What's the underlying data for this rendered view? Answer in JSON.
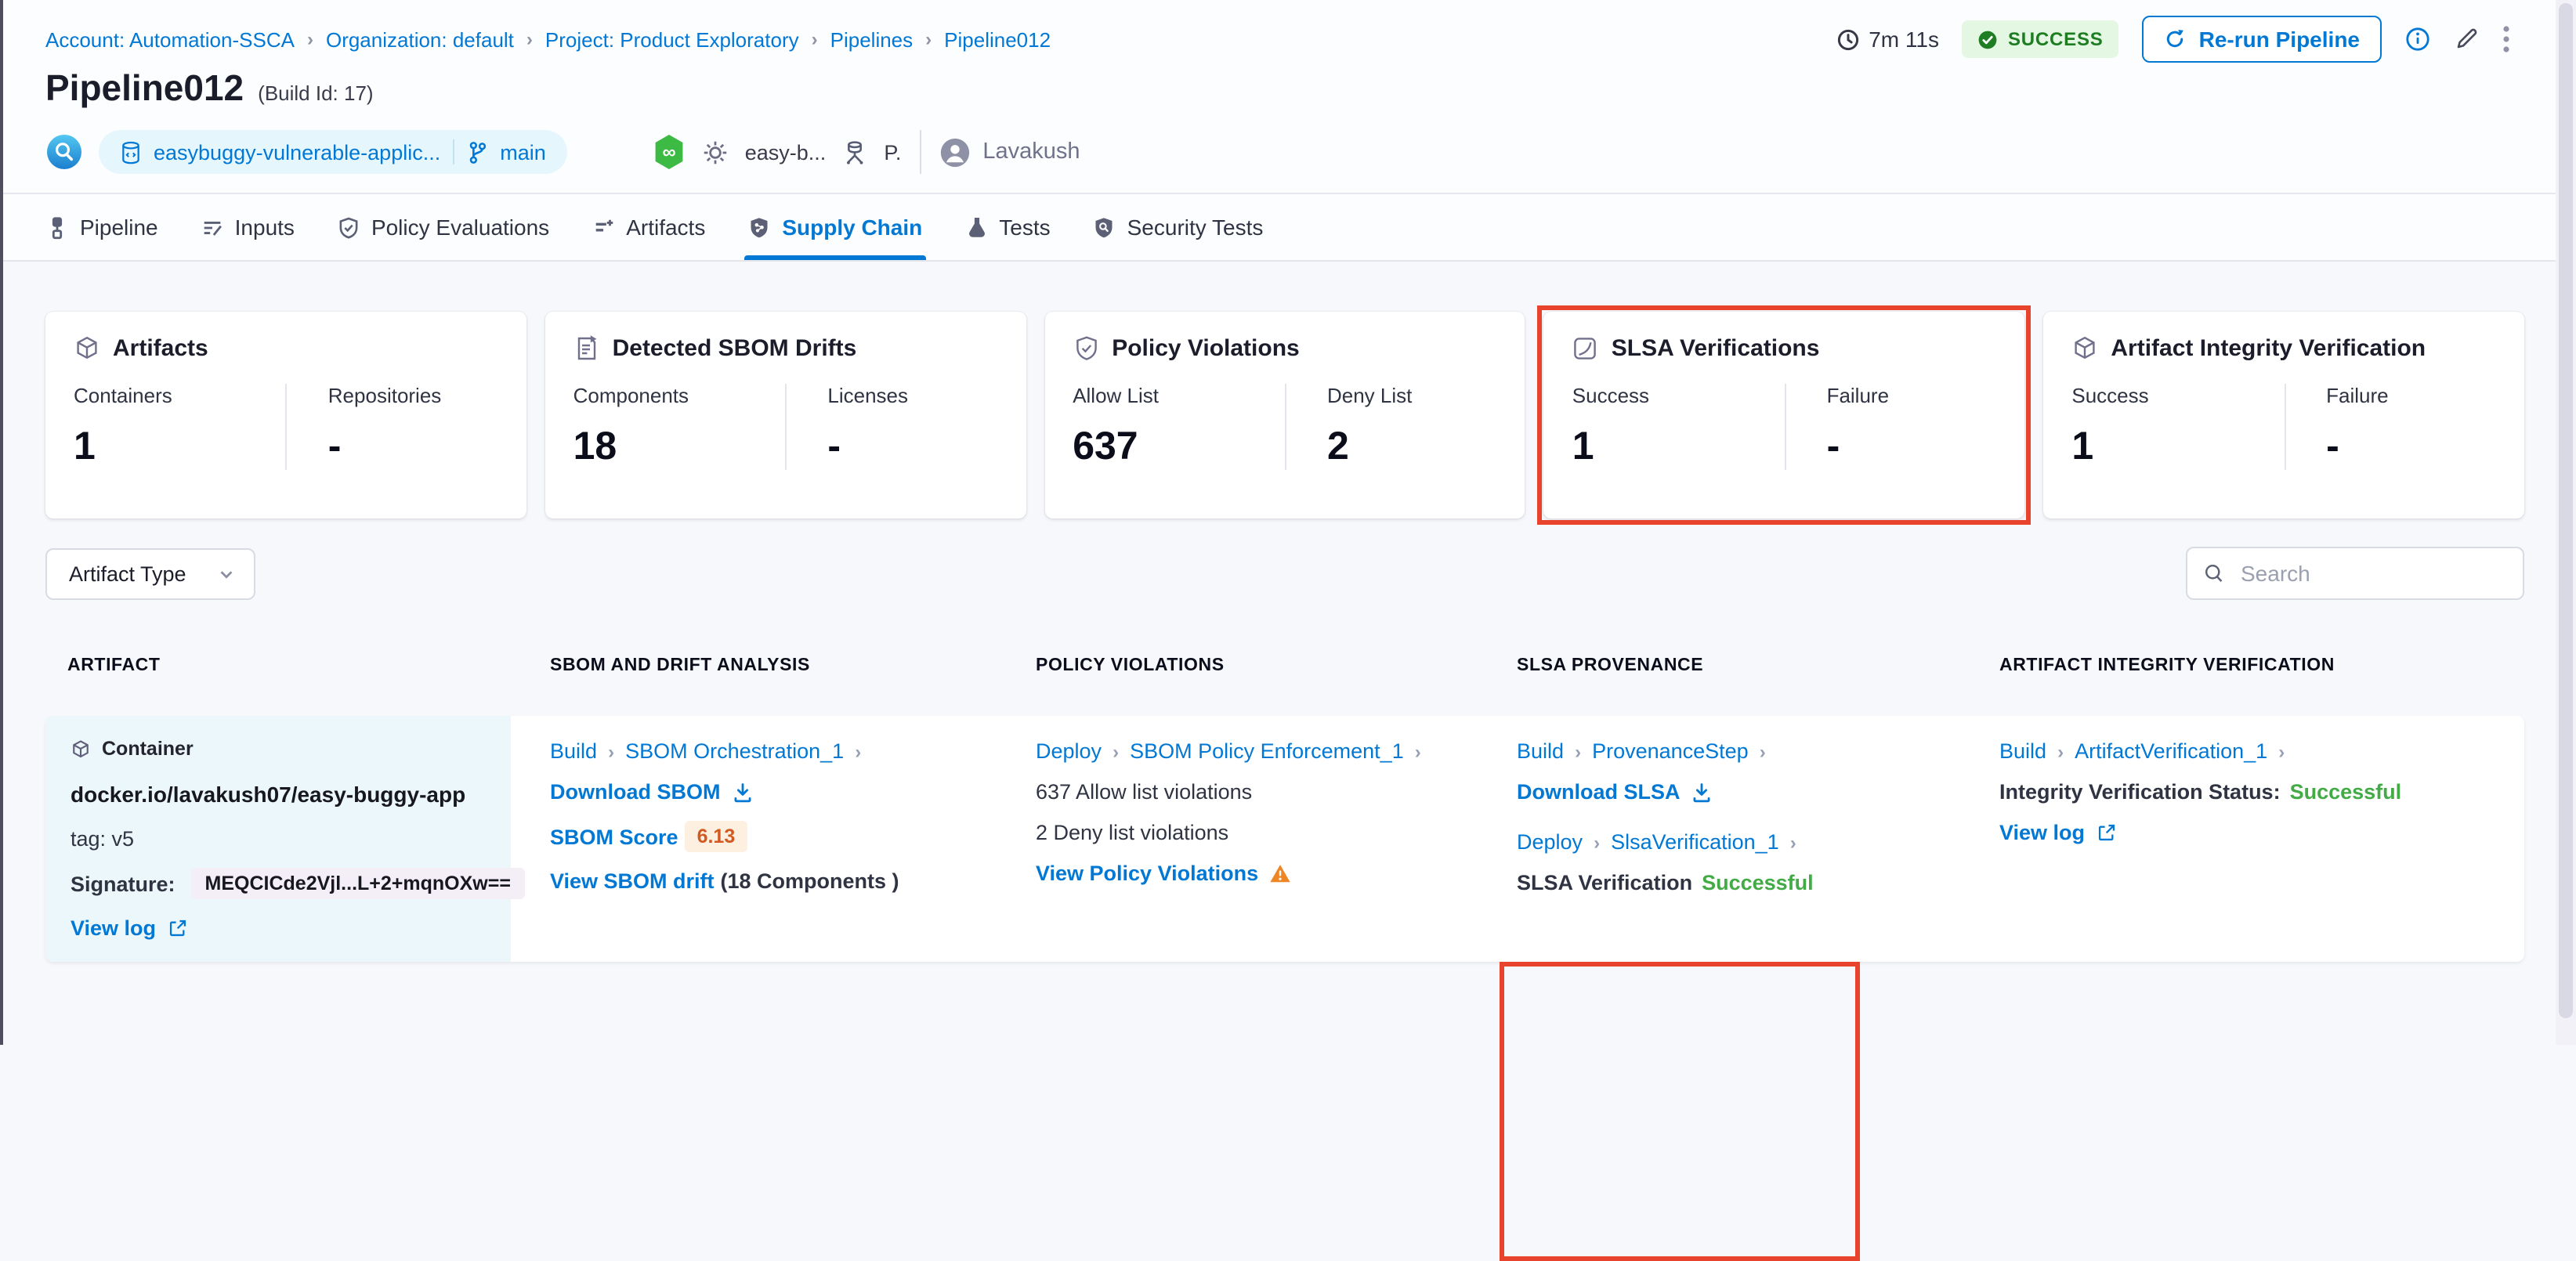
{
  "ui": {
    "chevron": "›"
  },
  "colors": {
    "accent_blue": "#0278d5",
    "success_green_text": "#1d7d21",
    "success_green_badge_bg": "#e3f7e3",
    "status_green": "#42ab45",
    "highlight_red": "#e8432c",
    "score_orange": "#d2591f",
    "score_bg": "#fdf0e0",
    "artifact_cell_bg": "#ecf7fc"
  },
  "breadcrumb": {
    "items": [
      "Account: Automation-SSCA",
      "Organization: default",
      "Project: Product Exploratory",
      "Pipelines",
      "Pipeline012"
    ]
  },
  "header": {
    "title": "Pipeline012",
    "build_id": "(Build Id: 17)",
    "duration": "7m 11s",
    "status": "SUCCESS",
    "rerun_label": "Re-run Pipeline",
    "repo_name": "easybuggy-vulnerable-applic...",
    "branch": "main",
    "trigger_name": "easy-b...",
    "trigger_detail": "P.",
    "user_name": "Lavakush"
  },
  "tabs": [
    {
      "label": "Pipeline"
    },
    {
      "label": "Inputs"
    },
    {
      "label": "Policy Evaluations"
    },
    {
      "label": "Artifacts"
    },
    {
      "label": "Supply Chain"
    },
    {
      "label": "Tests"
    },
    {
      "label": "Security Tests"
    }
  ],
  "cards": [
    {
      "title": "Artifacts",
      "stats": [
        {
          "label": "Containers",
          "value": "1"
        },
        {
          "label": "Repositories",
          "value": "-"
        }
      ]
    },
    {
      "title": "Detected SBOM Drifts",
      "stats": [
        {
          "label": "Components",
          "value": "18"
        },
        {
          "label": "Licenses",
          "value": "-"
        }
      ]
    },
    {
      "title": "Policy Violations",
      "stats": [
        {
          "label": "Allow List",
          "value": "637"
        },
        {
          "label": "Deny List",
          "value": "2"
        }
      ]
    },
    {
      "title": "SLSA Verifications",
      "stats": [
        {
          "label": "Success",
          "value": "1"
        },
        {
          "label": "Failure",
          "value": "-"
        }
      ]
    },
    {
      "title": "Artifact Integrity Verification",
      "stats": [
        {
          "label": "Success",
          "value": "1"
        },
        {
          "label": "Failure",
          "value": "-"
        }
      ]
    }
  ],
  "filters": {
    "artifact_type_label": "Artifact Type",
    "search_placeholder": "Search"
  },
  "table": {
    "columns": [
      "ARTIFACT",
      "SBOM AND DRIFT ANALYSIS",
      "POLICY VIOLATIONS",
      "SLSA PROVENANCE",
      "ARTIFACT INTEGRITY VERIFICATION"
    ],
    "row": {
      "artifact": {
        "type_label": "Container",
        "image_name": "docker.io/lavakush07/easy-buggy-app",
        "tag": "tag: v5",
        "signature_label": "Signature:",
        "signature_value": "MEQCICde2Vjl...L+2+mqnOXw==",
        "view_log": "View log"
      },
      "sbom": {
        "stage": "Build",
        "step": "SBOM Orchestration_1",
        "download_label": "Download SBOM",
        "score_label": "SBOM Score",
        "score_value": "6.13",
        "drift_link": "View SBOM drift",
        "drift_suffix": "(18 Components )"
      },
      "policy": {
        "stage": "Deploy",
        "step": "SBOM Policy Enforcement_1",
        "allow_text": "637 Allow list violations",
        "deny_text": "2 Deny list violations",
        "view_link": "View Policy Violations"
      },
      "slsa": {
        "stage1": "Build",
        "step1": "ProvenanceStep",
        "download_label": "Download SLSA",
        "stage2": "Deploy",
        "step2": "SlsaVerification_1",
        "status_label": "SLSA Verification",
        "status_value": "Successful"
      },
      "integrity": {
        "stage": "Build",
        "step": "ArtifactVerification_1",
        "status_label": "Integrity Verification Status:",
        "status_value": "Successful",
        "view_log": "View log"
      }
    }
  }
}
